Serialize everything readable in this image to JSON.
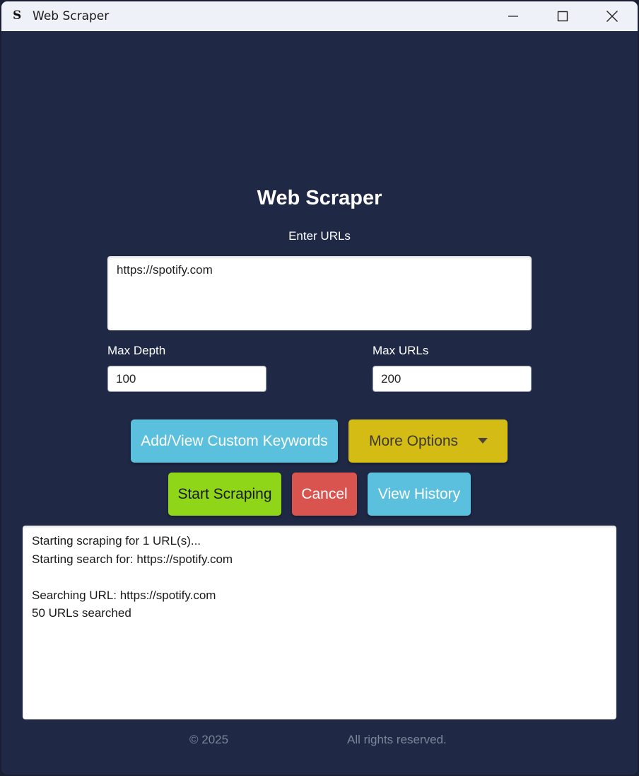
{
  "window": {
    "title": "Web Scraper",
    "icon_glyph": "S",
    "controls": [
      "minimize-icon",
      "maximize-icon",
      "close-icon"
    ]
  },
  "main": {
    "heading": "Web Scraper",
    "urls_label": "Enter URLs",
    "urls_value": "https://spotify.com",
    "max_depth": {
      "label": "Max Depth",
      "value": "100"
    },
    "max_urls": {
      "label": "Max URLs",
      "value": "200"
    }
  },
  "buttons": {
    "keywords": "Add/View Custom Keywords",
    "more_options": "More Options",
    "start": "Start Scraping",
    "cancel": "Cancel",
    "history": "View History"
  },
  "log": {
    "lines": [
      "Starting scraping for 1 URL(s)...",
      "Starting search for: https://spotify.com",
      "",
      "Searching URL: https://spotify.com",
      "50 URLs searched"
    ]
  },
  "footer": {
    "copyright": "© 2025",
    "rights": "All rights reserved."
  },
  "colors": {
    "background": "#1f2845",
    "keywords_button": "#5bc0de",
    "more_options_button": "#d4bc15",
    "start_button": "#8fd619",
    "cancel_button": "#d9534f",
    "history_button": "#5bc0de"
  }
}
